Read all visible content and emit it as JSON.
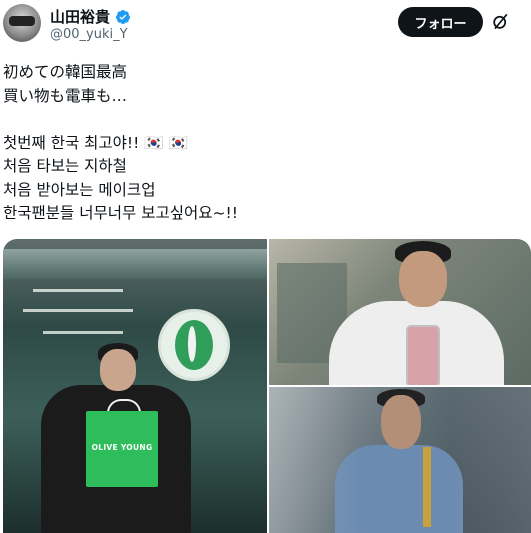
{
  "author": {
    "display_name": "山田裕貴",
    "handle": "@00_yuki_Y",
    "verified": true,
    "avatar_icon": "profile-avatar"
  },
  "header": {
    "follow_label": "フォロー",
    "grok_icon": "grok-icon"
  },
  "tweet": {
    "lines": [
      "初めての韓国最高",
      "買い物も電車も…",
      "",
      "첫번째 한국 최고야!! 🇰🇷 🇰🇷",
      "처음 타보는 지하철",
      "처음 받아보는 메이크업",
      "한국팬분들 너무너무 보고싶어요~!!"
    ]
  },
  "media": {
    "photos": [
      {
        "description_icon": "photo-olive-young"
      },
      {
        "description_icon": "photo-salon"
      },
      {
        "description_icon": "photo-subway"
      }
    ],
    "bag_text": "OLIVE YOUNG"
  },
  "colors": {
    "follow_bg": "#0f1419",
    "verified_blue": "#1d9bf0",
    "text_primary": "#0f1419",
    "text_secondary": "#536471",
    "olive_green": "#2ebd5b"
  }
}
